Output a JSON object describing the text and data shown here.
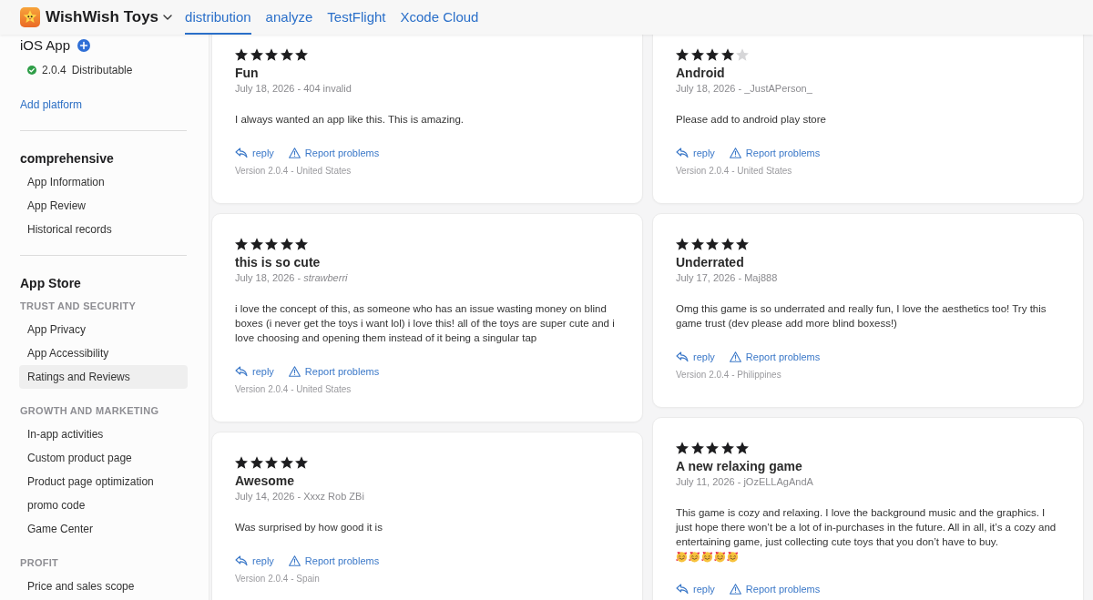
{
  "header": {
    "app_name": "WishWish Toys",
    "tabs": [
      {
        "label": "distribution",
        "selected": true
      },
      {
        "label": "analyze",
        "selected": false
      },
      {
        "label": "TestFlight",
        "selected": false
      },
      {
        "label": "Xcode Cloud",
        "selected": false
      }
    ]
  },
  "sidebar": {
    "platform": {
      "title": "iOS App",
      "version": "2.0.4",
      "status": "Distributable"
    },
    "add_platform": "Add platform",
    "sections": [
      {
        "title": "comprehensive",
        "groups": [
          {
            "items": [
              {
                "label": "App Information",
                "selected": false
              },
              {
                "label": "App Review",
                "selected": false
              },
              {
                "label": "Historical records",
                "selected": false
              }
            ]
          }
        ]
      },
      {
        "title": "App Store",
        "groups": [
          {
            "heading": "TRUST AND SECURITY",
            "items": [
              {
                "label": "App Privacy",
                "selected": false
              },
              {
                "label": "App Accessibility",
                "selected": false
              },
              {
                "label": "Ratings and Reviews",
                "selected": true
              }
            ]
          },
          {
            "heading": "GROWTH AND MARKETING",
            "items": [
              {
                "label": "In-app activities",
                "selected": false
              },
              {
                "label": "Custom product page",
                "selected": false
              },
              {
                "label": "Product page optimization",
                "selected": false
              },
              {
                "label": "promo code",
                "selected": false
              },
              {
                "label": "Game Center",
                "selected": false
              }
            ]
          },
          {
            "heading": "PROFIT",
            "items": [
              {
                "label": "Price and sales scope",
                "selected": false
              }
            ]
          }
        ]
      }
    ]
  },
  "review_columns": [
    {
      "reviews": [
        {
          "stars": 5,
          "title": "Fun",
          "meta": "July 18, 2026 - 404 invalid",
          "body": "I always wanted an app like this. This is amazing.",
          "reply": "reply",
          "report": "Report problems",
          "version": "Version 2.0.4 - United States"
        },
        {
          "stars": 5,
          "title": "this is so cute",
          "meta": "July 18, 2026 - *strawberri*",
          "body": "i love the concept of this, as someone who has an issue wasting money on blind boxes (i never get the toys i want lol) i love this! all of the toys are super cute and i love choosing and opening them instead of it being a singular tap",
          "reply": "reply",
          "report": "Report problems",
          "version": "Version 2.0.4 - United States"
        },
        {
          "stars": 5,
          "title": "Awesome",
          "meta": "July 14, 2026 - Xxxz Rob ZBi",
          "body": "Was surprised by how good it is",
          "reply": "reply",
          "report": "Report problems",
          "version": "Version 2.0.4 - Spain"
        }
      ]
    },
    {
      "reviews": [
        {
          "stars": 4,
          "title": "Android",
          "meta": "July 18, 2026 - _JustAPerson_",
          "body": "Please add to android play store",
          "reply": "reply",
          "report": "Report problems",
          "version": "Version 2.0.4 - United States"
        },
        {
          "stars": 5,
          "title": "Underrated",
          "meta": "July 17, 2026 - Maj888",
          "body": "Omg this game is so underrated and really fun, I love the aesthetics too! Try this game trust (dev please add more blind boxess!)",
          "reply": "reply",
          "report": "Report problems",
          "version": "Version 2.0.4 - Philippines"
        },
        {
          "stars": 5,
          "title": "A new relaxing game",
          "meta": "July 11, 2026 - jOzELLAgAndA",
          "body": "This game is cozy and relaxing. I love the background music and the graphics. I just hope there won’t be a lot of in-purchases in the future. All in all, it’s a cozy and entertaining game, just collecting cute toys that you don’t have to buy.",
          "emojis": [
            {
              "kind": "smiling-face-with-hearts"
            },
            {
              "kind": "smiling-face-with-hearts"
            },
            {
              "kind": "smiling-face-with-hearts"
            },
            {
              "kind": "smiling-face-with-hearts"
            },
            {
              "kind": "smiling-face-with-hearts"
            }
          ],
          "reply": "reply",
          "report": "Report problems"
        }
      ]
    }
  ]
}
